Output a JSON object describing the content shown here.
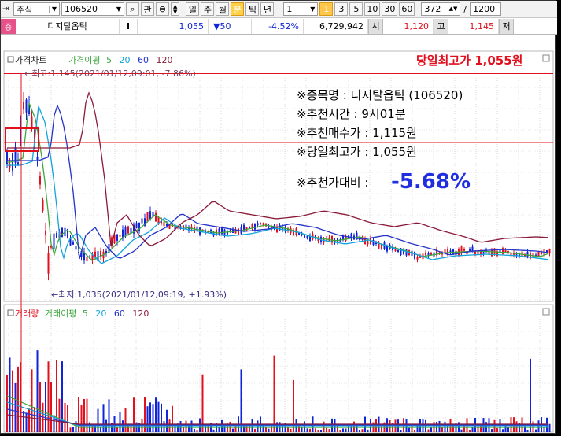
{
  "toolbar": {
    "market_type": "주식",
    "stock_code": "106520",
    "search_icon": "magnifier-icon",
    "interest_label": "관",
    "period_buttons": [
      "일",
      "주",
      "월",
      "분",
      "틱",
      "년"
    ],
    "active_period": "분",
    "interval_value": "1",
    "interval_badge": "1",
    "interval_buttons": [
      "3",
      "5",
      "10",
      "30",
      "60"
    ],
    "bar_count": "372",
    "slash": "/",
    "max_count": "1200"
  },
  "quote": {
    "badge": "증",
    "name": "디지탈옵틱",
    "info_label": "i",
    "price": "1,055",
    "change": "▼50",
    "change_pct": "-4.52%",
    "volume": "6,729,942",
    "open_label": "시",
    "open": "1,120",
    "high_label": "고",
    "high": "1,145",
    "low_label": "저"
  },
  "colors": {
    "up": "#e0101e",
    "down": "#1024d8",
    "ma5": "#3fa63f",
    "ma20": "#12a4dc",
    "ma60": "#2533c8",
    "ma120": "#8a1a3a",
    "annotation_red": "#e0101e",
    "highlight_blue": "#1f2fe0"
  },
  "price_legend": {
    "name": "가격차트",
    "ma_label": "가격이평",
    "ma_periods": [
      "5",
      "20",
      "60",
      "120"
    ]
  },
  "volume_legend": {
    "name": "거래량",
    "ma_label": "거래이평",
    "ma_periods": [
      "5",
      "20",
      "60",
      "120"
    ]
  },
  "annotations": {
    "today_high": "당일최고가 1,055원",
    "max_label": "←최고:1,145(2021/01/12,09:01, -7.86%)",
    "min_label": "←최저:1,035(2021/01/12,09:19, +1.93%)"
  },
  "recommendation": {
    "stock_line": "※종목명 : 디지탈옵틱 (106520)",
    "time_line": "※추천시간 : 9시01분",
    "buy_line": "※추천매수가 : 1,115원",
    "high_line": "※당일최고가 : 1,055원",
    "ratio_label": "※추천가대비 :",
    "ratio_value": "-5.68%"
  }
}
